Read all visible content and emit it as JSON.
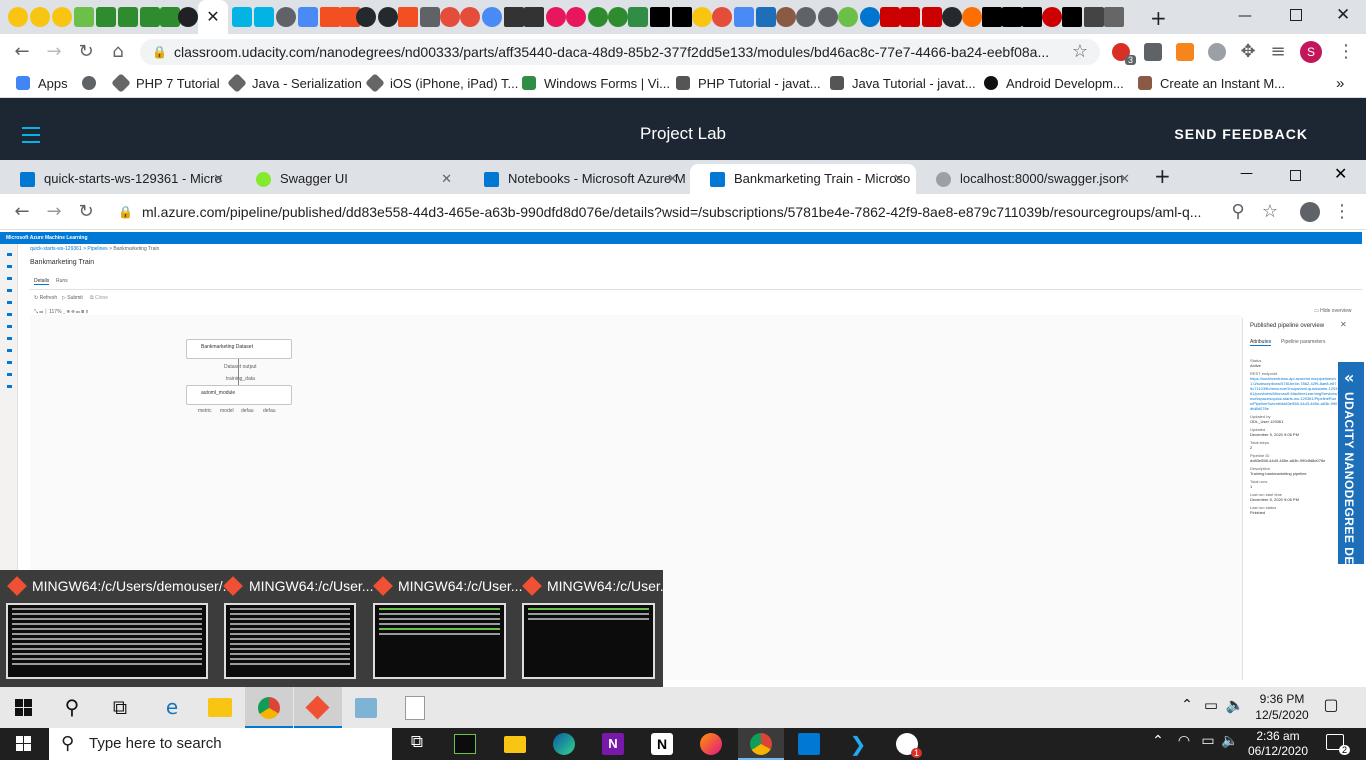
{
  "outer_browser": {
    "url": "classroom.udacity.com/nanodegrees/nd00333/parts/aff35440-daca-48d9-85b2-377f2dd5e133/modules/bd46ac8c-77e7-4466-ba24-eebf08a...",
    "profile_initial": "S",
    "extension_badge": "3",
    "bookmarks": [
      "Apps",
      "PHP 7 Tutorial",
      "Java - Serialization",
      "iOS (iPhone, iPad) T...",
      "Windows Forms | Vi...",
      "PHP Tutorial - javat...",
      "Java Tutorial - javat...",
      "Android Developm...",
      "Create an Instant M..."
    ],
    "more_bookmarks": "»"
  },
  "udacity": {
    "title": "Project Lab",
    "feedback": "SEND FEEDBACK",
    "demo_badge": "UDACITY NANODEGREE DEMO"
  },
  "inner_browser": {
    "tabs": [
      {
        "label": "quick-starts-ws-129361 - Micro",
        "color": "#0078d4"
      },
      {
        "label": "Swagger UI",
        "color": "#85ea2d"
      },
      {
        "label": "Notebooks - Microsoft Azure M",
        "color": "#0078d4"
      },
      {
        "label": "Bankmarketing Train - Microso",
        "color": "#0078d4"
      },
      {
        "label": "localhost:8000/swagger.json",
        "color": "#5f6368"
      }
    ],
    "url": "ml.azure.com/pipeline/published/dd83e558-44d3-465e-a63b-990dfd8d076e/details?wsid=/subscriptions/5781be4e-7862-42f9-8ae8-e879c711039b/resourcegroups/aml-q..."
  },
  "azure": {
    "brand": "Microsoft Azure Machine Learning",
    "breadcrumb": [
      "quick-starts-ws-129361",
      "Pipelines",
      "Bankmarketing Train"
    ],
    "page_title": "Bankmarketing Train",
    "tabs": [
      "Details",
      "Runs"
    ],
    "toolbar": [
      "Refresh",
      "Submit",
      "Clone"
    ],
    "zoom": "117%",
    "hide_overview": "Hide overview",
    "node1": "Bankmarketing Dataset",
    "port1": "Dataset output",
    "port2": "training_data",
    "node2": "automl_module",
    "outputs": [
      "metric",
      "model",
      "defau",
      "defau"
    ],
    "panel": {
      "title": "Published pipeline overview",
      "tabs": [
        "Attributes",
        "Pipeline parameters"
      ],
      "fields": [
        {
          "label": "Status",
          "value": "Active"
        },
        {
          "label": "REST endpoint",
          "value": "https://southcentralus.api.azureml.ms/pipelines/v1.0/subscriptions/5781be4e-7862-42f9-8ae8-e879c711039b/resourceGroups/aml-quickstarts-129361/providers/Microsoft.MachineLearningServices/workspaces/quick-starts-ws-129361/PipelineRuns/PipelineSubmit/dd83e558-44d3-465e-a63b-990dfd8d076e"
        },
        {
          "label": "Updated by",
          "value": "ODL_User 129361"
        },
        {
          "label": "Updated",
          "value": "December 5, 2020 9:06 PM"
        },
        {
          "label": "Total steps",
          "value": "2"
        },
        {
          "label": "Pipeline ID",
          "value": "dd83e558-44d3-465e-a63b-990dfd8d076e"
        },
        {
          "label": "Description",
          "value": "Training bankmarketing pipeline"
        },
        {
          "label": "Total runs",
          "value": "1"
        },
        {
          "label": "Last run start time",
          "value": "December 5, 2020 9:06 PM"
        },
        {
          "label": "Last run status",
          "value": "Finished"
        }
      ]
    }
  },
  "popup_windows": [
    "MINGW64:/c/Users/demouser/...",
    "MINGW64:/c/User...",
    "MINGW64:/c/User...",
    "MINGW64:/c/User..."
  ],
  "taskbar_inner": {
    "time": "9:36 PM",
    "date": "12/5/2020"
  },
  "taskbar_outer": {
    "search_placeholder": "Type here to search",
    "time": "2:36 am",
    "date": "06/12/2020",
    "notif_count": "2",
    "app_badge": "1"
  }
}
